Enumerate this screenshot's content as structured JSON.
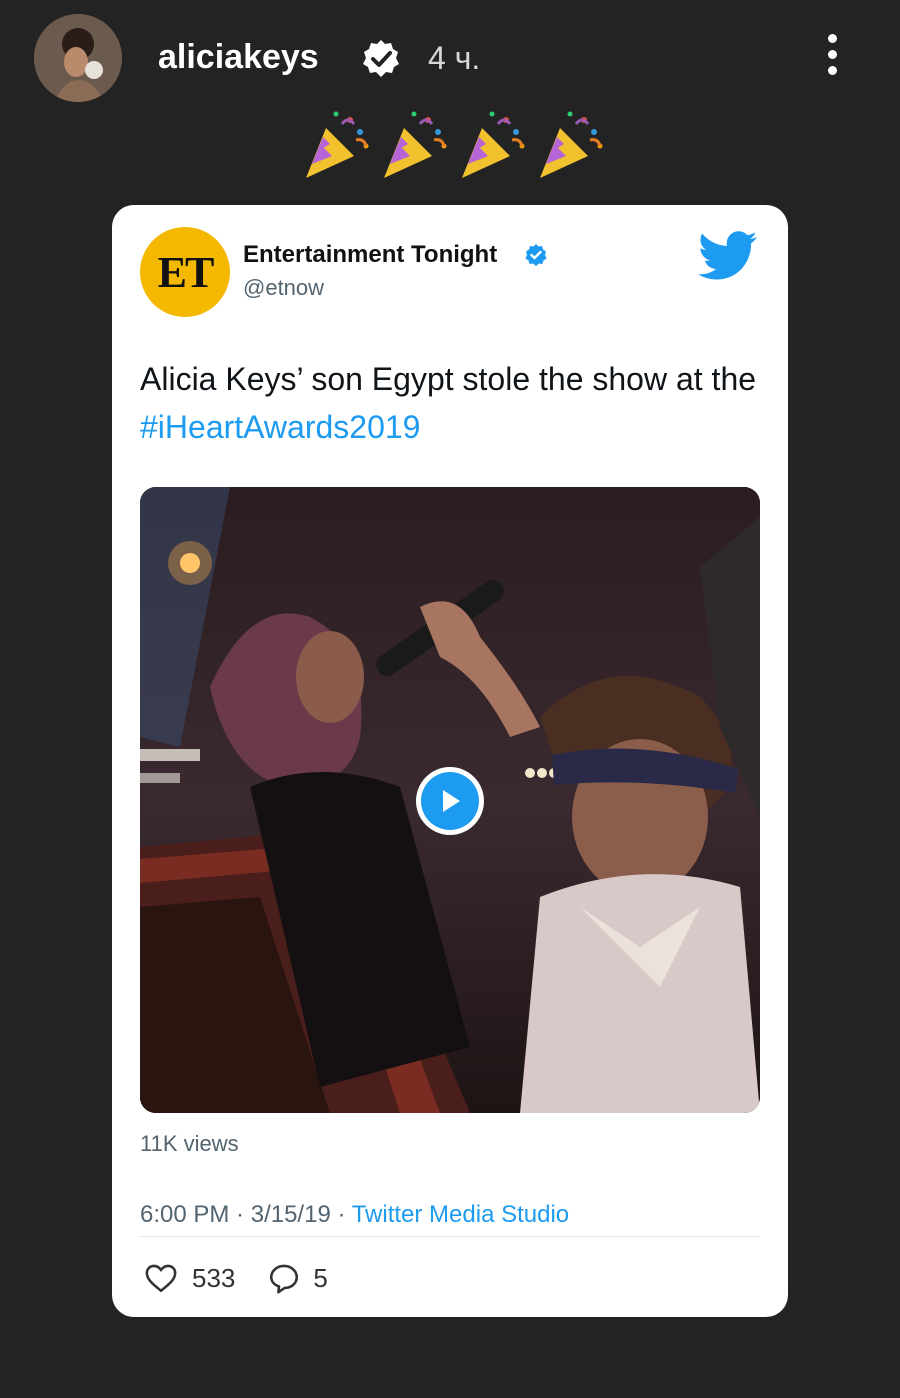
{
  "story": {
    "username": "aliciakeys",
    "time_ago": "4 ч.",
    "sticker_icon": "party-popper-icon"
  },
  "tweet": {
    "account_name": "Entertainment Tonight",
    "account_handle": "@etnow",
    "logo_text": "ET",
    "text_before": "Alicia Keys’ son Egypt stole the show at the ",
    "hashtag": "#iHeartAwards2019",
    "views": "11K views",
    "time": "6:00 PM",
    "date": "3/15/19",
    "source": "Twitter Media Studio",
    "likes": "533",
    "replies": "5"
  },
  "colors": {
    "background": "#232323",
    "twitter_blue": "#1d9bf0",
    "et_yellow": "#f5b800",
    "verified_blue": "#1d9bf0"
  }
}
